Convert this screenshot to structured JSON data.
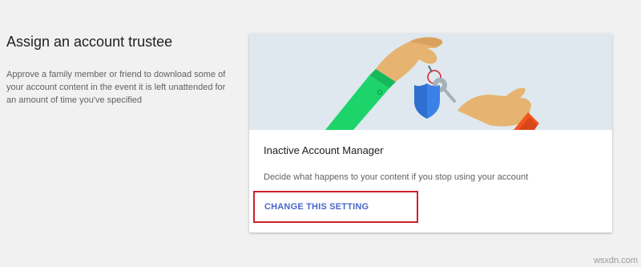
{
  "section": {
    "title": "Assign an account trustee",
    "description": "Approve a family member or friend to download some of your account content in the event it is left unattended for an amount of time you've specified"
  },
  "card": {
    "illustration_icons": [
      "hand-with-key-icon",
      "shield-icon",
      "receiving-hand-icon"
    ],
    "title": "Inactive Account Manager",
    "description": "Decide what happens to your content if you stop using your account",
    "action_label": "CHANGE THIS SETTING"
  },
  "watermark": "wsxdn.com",
  "colors": {
    "page_background": "#f1f1f1",
    "illustration_background": "#dfe8ee",
    "action_text": "#4a66c9",
    "highlight_border": "#d0202c",
    "shield": "#3b82e8",
    "sleeve_green": "#1cd46a",
    "sleeve_orange": "#f2561d",
    "skin": "#e6b470"
  }
}
